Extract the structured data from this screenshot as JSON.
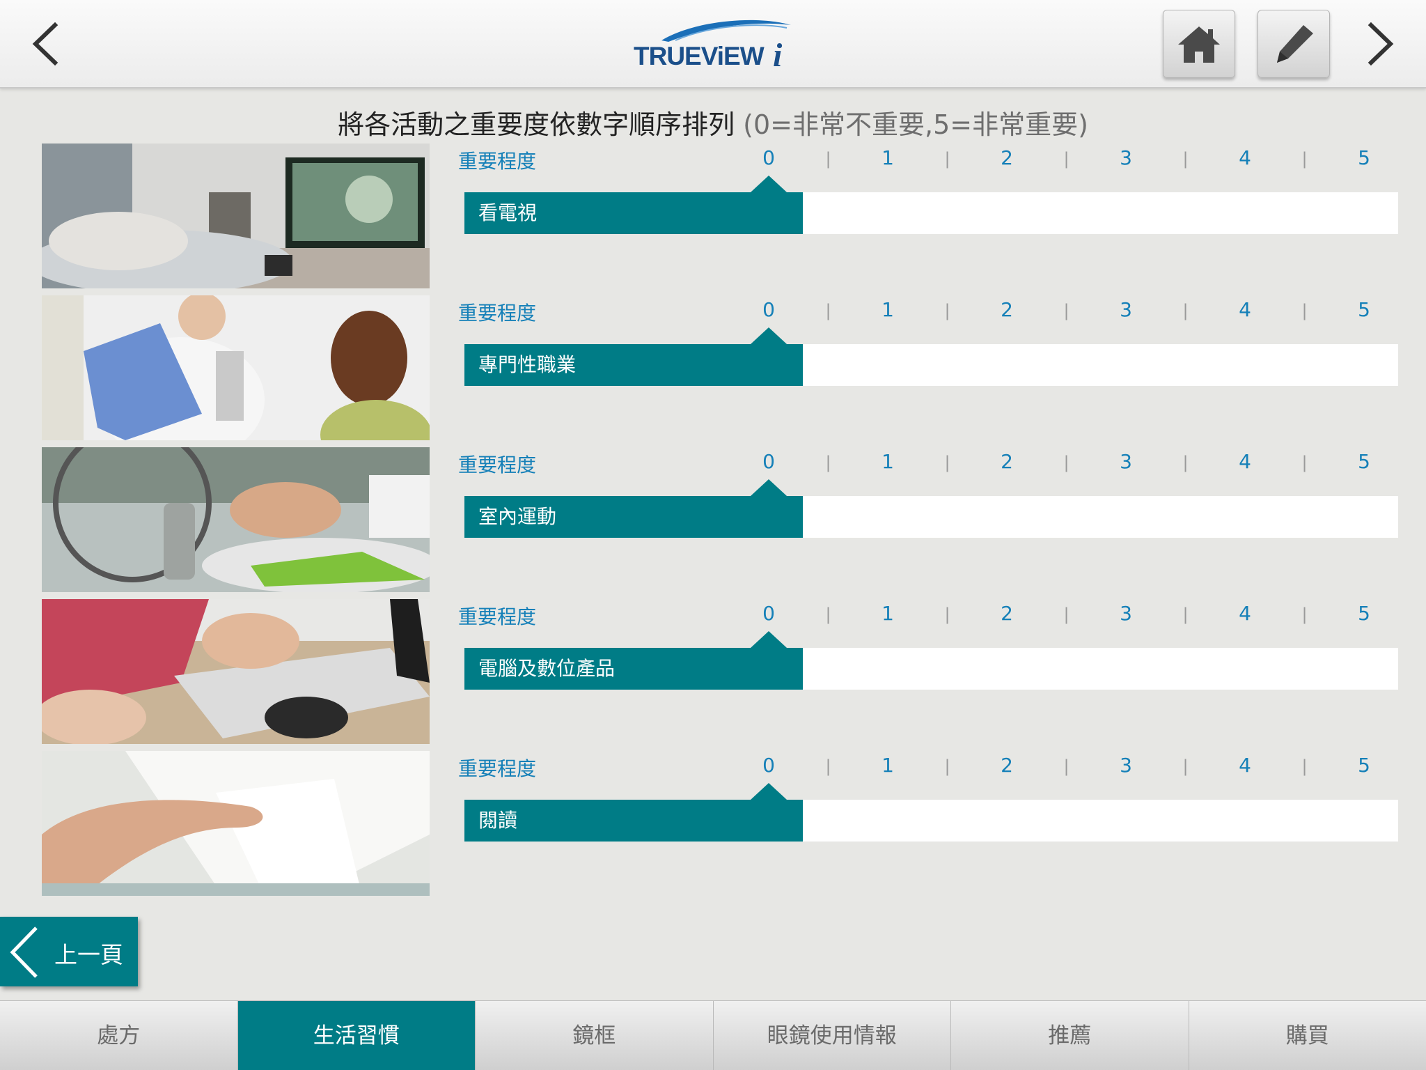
{
  "header": {
    "logo_text": "TRUEViEW",
    "logo_suffix": "i",
    "icons": {
      "back": "chevron-left-icon",
      "forward": "chevron-right-icon",
      "home": "home-icon",
      "edit": "pencil-icon"
    }
  },
  "instruction": {
    "main": "將各活動之重要度依數字順序排列",
    "note": "(0=非常不重要,5=非常重要)"
  },
  "scale": {
    "label": "重要程度",
    "ticks": [
      "0",
      "1",
      "2",
      "3",
      "4",
      "5"
    ],
    "separator": "|"
  },
  "activities": [
    {
      "label": "看電視",
      "value": 0,
      "photo": "watching-tv-photo"
    },
    {
      "label": "專門性職業",
      "value": 0,
      "photo": "doctor-patient-photo"
    },
    {
      "label": "室內運動",
      "value": 0,
      "photo": "tying-shoes-photo"
    },
    {
      "label": "電腦及數位產品",
      "value": 0,
      "photo": "laptop-typing-photo"
    },
    {
      "label": "閱讀",
      "value": 0,
      "photo": "reading-page-photo"
    }
  ],
  "prev_button": {
    "label": "上一頁"
  },
  "tabs": [
    {
      "label": "處方",
      "active": false
    },
    {
      "label": "生活習慣",
      "active": true
    },
    {
      "label": "鏡框",
      "active": false
    },
    {
      "label": "眼鏡使用情報",
      "active": false
    },
    {
      "label": "推薦",
      "active": false
    },
    {
      "label": "購買",
      "active": false
    }
  ],
  "colors": {
    "accent": "#007c86",
    "scale_text": "#1580b8",
    "background": "#e7e7e4"
  }
}
